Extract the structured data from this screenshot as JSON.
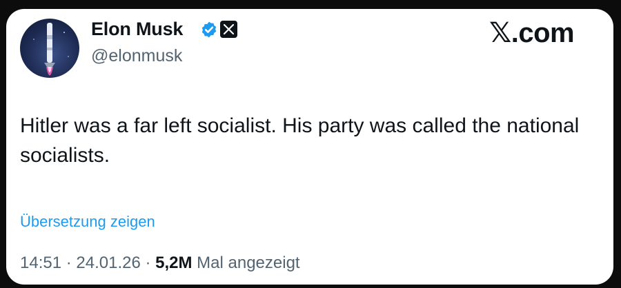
{
  "post": {
    "author": {
      "display_name": "Elon Musk",
      "handle": "@elonmusk",
      "verified_icon": "verified-badge-icon",
      "affiliation_icon": "x-logo-icon"
    },
    "brand": {
      "glyph": "𝕏",
      "suffix": ".com"
    },
    "text": "Hitler was a far left socialist. His party was called the national socialists.",
    "translate_label": "Übersetzung zeigen",
    "meta": {
      "time": "14:51",
      "sep1": " · ",
      "date": "24.01.26",
      "sep2": " · ",
      "views_count": "5,2M",
      "views_label": " Mal angezeigt"
    }
  },
  "colors": {
    "text_primary": "#0f1419",
    "text_secondary": "#536471",
    "link": "#1d9bf0",
    "card_background": "#ffffff",
    "page_background": "#0c0c0c"
  }
}
